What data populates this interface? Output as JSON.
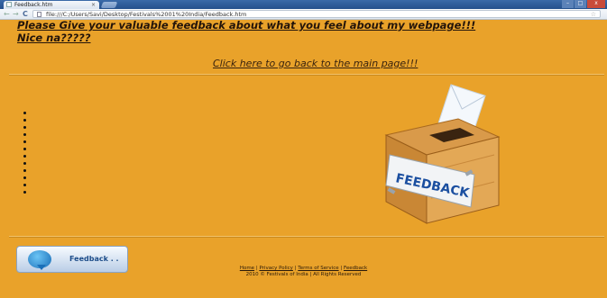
{
  "browser": {
    "tab_title": "Feedback.htm",
    "tab_close": "×",
    "url": "file:///C:/Users/Savi/Desktop/Festivals%2001%20India/Feedback.htm",
    "back_glyph": "←",
    "forward_glyph": "→",
    "reload_glyph": "C",
    "minimize_glyph": "–",
    "maximize_glyph": "□",
    "close_glyph": "x",
    "star_glyph": "☆"
  },
  "page": {
    "heading": "Please Give your valuable feedback about what you feel about my webpage!!! Nice na?????",
    "back_link": "Click here to go back to the main page!!!",
    "bullet_count": 12,
    "feedback_box_label": "FEEDBACK",
    "feedback_button_label": "Feedback . .",
    "footer": {
      "links": [
        "Home",
        "Privacy Policy",
        "Terms of Service",
        "Feedback"
      ],
      "separator": " | ",
      "copyright": "2010 © Festivals of India | All Rights Reserved"
    }
  },
  "colors": {
    "page_background": "#e9a22a",
    "heading_text": "#23140a",
    "titlebar": "#2d5c9a"
  }
}
